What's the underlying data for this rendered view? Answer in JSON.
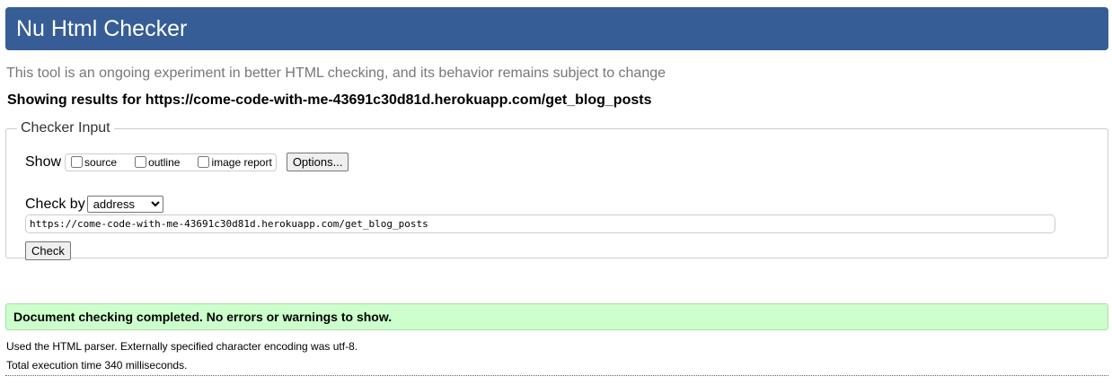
{
  "header": {
    "title": "Nu Html Checker"
  },
  "subtitle": "This tool is an ongoing experiment in better HTML checking, and its behavior remains subject to change",
  "results_heading": "Showing results for https://come-code-with-me-43691c30d81d.herokuapp.com/get_blog_posts",
  "checker_input": {
    "legend": "Checker Input",
    "show_label": "Show",
    "show_options": [
      {
        "label": "source",
        "checked": false
      },
      {
        "label": "outline",
        "checked": false
      },
      {
        "label": "image report",
        "checked": false
      }
    ],
    "options_button": "Options...",
    "check_by_label": "Check by",
    "check_by_selected": "address",
    "url_value": "https://come-code-with-me-43691c30d81d.herokuapp.com/get_blog_posts",
    "check_button": "Check"
  },
  "result": {
    "message": "Document checking completed. No errors or warnings to show.",
    "details": [
      "Used the HTML parser. Externally specified character encoding was utf-8.",
      "Total execution time 340 milliseconds."
    ]
  },
  "colors": {
    "banner": "#365d95",
    "success_background": "#ccffcc"
  }
}
